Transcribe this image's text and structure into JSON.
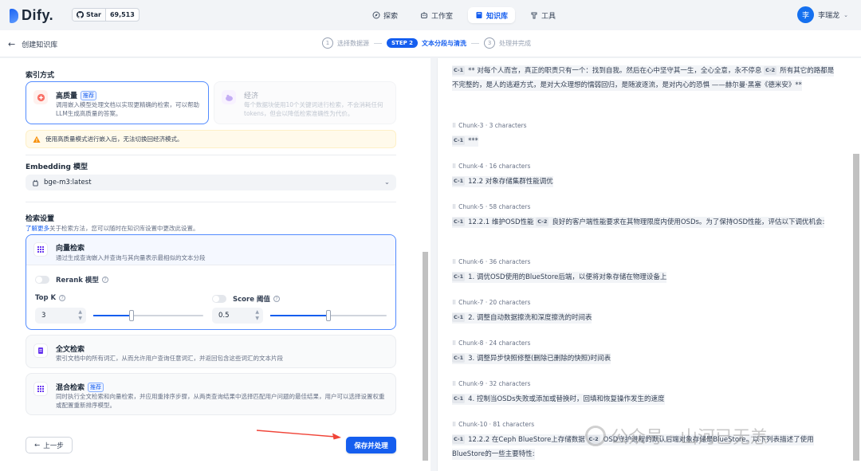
{
  "brand": {
    "name": "Dify."
  },
  "github": {
    "label": "Star",
    "count": "69,513"
  },
  "nav": [
    {
      "label": "探索",
      "icon": "compass-icon"
    },
    {
      "label": "工作室",
      "icon": "robot-icon"
    },
    {
      "label": "知识库",
      "icon": "book-icon",
      "active": true
    },
    {
      "label": "工具",
      "icon": "tool-icon"
    }
  ],
  "user": {
    "avatar": "李",
    "name": "李瑞龙"
  },
  "subbar": {
    "back_label": "创建知识库",
    "steps": [
      {
        "num": "1",
        "label": "选择数据源"
      },
      {
        "badge": "STEP 2",
        "label": "文本分段与清洗"
      },
      {
        "num": "3",
        "label": "处理并完成"
      }
    ]
  },
  "index": {
    "title": "索引方式",
    "high": {
      "title": "高质量",
      "tag": "推荐",
      "desc": "调用嵌入模型处理文档以实现更精确的检索，可以帮助LLM生成高质量的答案。"
    },
    "eco": {
      "title": "经济",
      "desc": "每个数据块使用10个关键词进行检索，不会消耗任何tokens，但会以降低检索准确性为代价。"
    },
    "warning": "使用高质量模式进行嵌入后，无法切换回经济模式。"
  },
  "embedding": {
    "title": "Embedding 模型",
    "value": "bge-m3:latest"
  },
  "retrieval": {
    "title": "检索设置",
    "hint_link": "了解更多",
    "hint_text": "关于检索方法，您可以随时在知识库设置中更改此设置。",
    "vector": {
      "title": "向量检索",
      "desc": "通过生成查询嵌入并查询与其向量表示最相似的文本分段"
    },
    "rerank_label": "Rerank 模型",
    "topk_label": "Top K",
    "topk_value": "3",
    "topk_level": 0.35,
    "score_label": "Score 阈值",
    "score_value": "0.5",
    "score_level": 0.5,
    "fulltext": {
      "title": "全文检索",
      "desc": "索引文档中的所有词汇，从而允许用户查询任意词汇，并返回包含这些词汇的文本片段"
    },
    "hybrid": {
      "title": "混合检索",
      "tag": "推荐",
      "desc": "同时执行全文检索和向量检索，并应用重排序步骤，从两类查询结果中选择匹配用户问题的最佳结果，用户可以选择设置权重或配置重新排序模型。"
    }
  },
  "buttons": {
    "prev": "上一步",
    "save": "保存并处理"
  },
  "chunks": {
    "first": {
      "tag1": "C-1",
      "text1": "** 对每个人而言，真正的职责只有一个：找到自我。然后在心中坚守其一生，全心全意，永不停息",
      "tag2": "C-2",
      "text2": "所有其它的路都是不完整的，是人的逃避方式，是对大众理想的懦弱回归，是随波逐流，是对内心的恐惧 ——赫尔曼·黑塞《德米安》**"
    },
    "items": [
      {
        "meta": "Chunk-3 · 3 characters",
        "tag": "C-1",
        "text": "***"
      },
      {
        "meta": "Chunk-4 · 16 characters",
        "tag": "C-1",
        "text": "12.2 对象存储集群性能调优"
      },
      {
        "meta": "Chunk-5 · 58 characters",
        "tag": "C-1",
        "text": "12.2.1 维护OSD性能",
        "tag2": "C-2",
        "text2": "良好的客户端性能要求在其物理限度内使用OSDs。为了保持OSD性能，评估以下调优机会:"
      },
      {
        "meta": "Chunk-6 · 36 characters",
        "tag": "C-1",
        "text": "1. 调优OSD使用的BlueStore后端，以便将对象存储在物理设备上"
      },
      {
        "meta": "Chunk-7 · 20 characters",
        "tag": "C-1",
        "text": "2. 调整自动数据擦洗和深度擦洗的时间表"
      },
      {
        "meta": "Chunk-8 · 24 characters",
        "tag": "C-1",
        "text": "3. 调整异步快照修整(删除已删除的快照)时间表"
      },
      {
        "meta": "Chunk-9 · 32 characters",
        "tag": "C-1",
        "text": "4. 控制当OSDs失败或添加或替换时，回填和恢复操作发生的速度"
      },
      {
        "meta": "Chunk-10 · 81 characters",
        "tag": "C-1",
        "text": "12.2.2 在Ceph BlueStore上存储数据",
        "tag2": "C-2",
        "text2": "OSD守护进程的默认后端对象存储是BlueStore。以下列表描述了使用BlueStore的一些主要特性:"
      }
    ]
  },
  "watermark": "公众号 · 山河已无恙",
  "colors": {
    "accent": "#155eef",
    "warning_bg": "#fffaeb",
    "arrow": "#f04438"
  }
}
